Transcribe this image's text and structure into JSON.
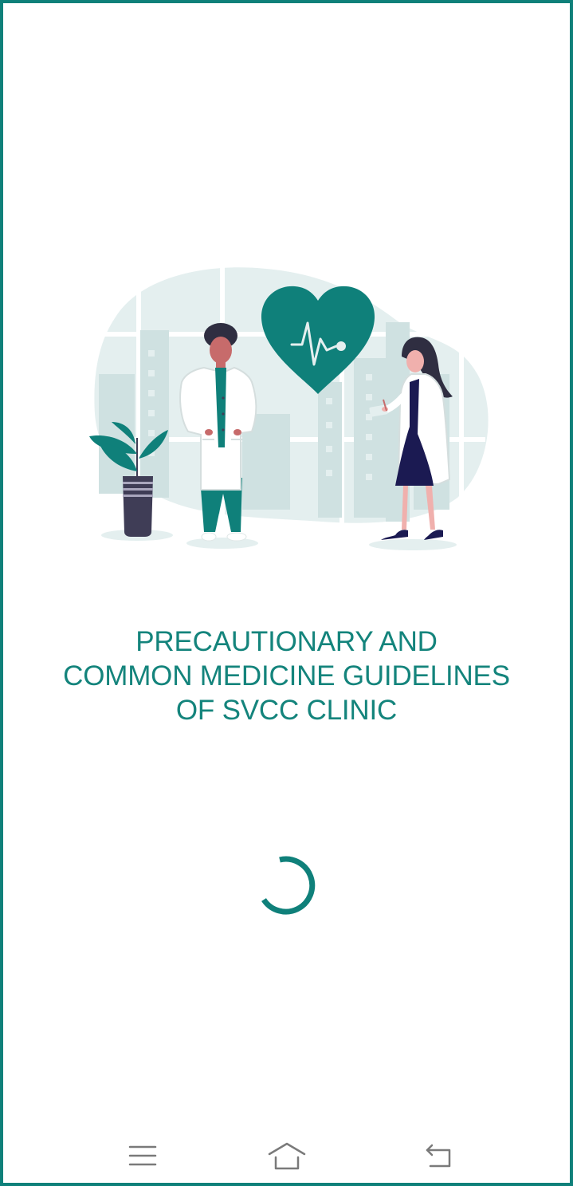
{
  "app": {
    "title_lines": [
      "PRECAUTIONARY AND",
      "COMMON MEDICINE GUIDELINES",
      "OF SVCC CLINIC"
    ]
  },
  "illustration": {
    "name": "doctors-with-heart-illustration",
    "accent_color": "#0f807a"
  },
  "loading": {
    "icon": "loading-spinner-icon",
    "color": "#0f807a"
  },
  "navigation_bar": {
    "buttons": [
      {
        "icon": "menu-icon"
      },
      {
        "icon": "home-icon"
      },
      {
        "icon": "back-icon"
      }
    ]
  },
  "colors": {
    "brand": "#0f807a",
    "title_text": "#14847c",
    "background": "#ffffff"
  }
}
